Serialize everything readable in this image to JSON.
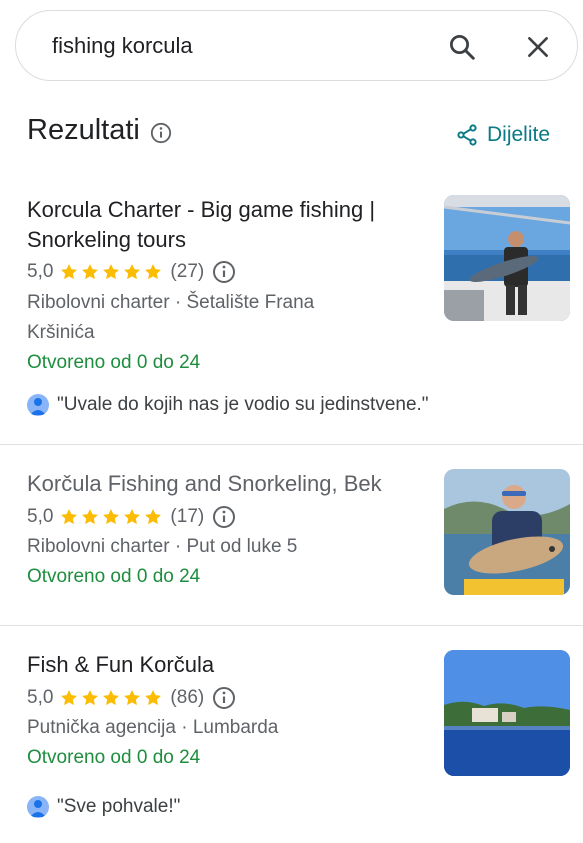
{
  "search": {
    "query": "fishing korcula"
  },
  "header": {
    "title": "Rezultati",
    "share_label": "Dijelite"
  },
  "results": [
    {
      "title": "Korcula Charter - Big game fishing | Snorkeling tours",
      "rating": "5,0",
      "stars": 5,
      "reviews_count": "(27)",
      "meta_line1": "Ribolovni charter · Šetalište Frana",
      "meta_line2": "Kršinića",
      "hours": "Otvoreno od 0 do 24",
      "review": "\"Uvale do kojih nas je vodio su jedinstvene.\""
    },
    {
      "title": "Korčula Fishing and Snorkeling, Bek",
      "rating": "5,0",
      "stars": 5,
      "reviews_count": "(17)",
      "meta_line1": "Ribolovni charter · Put od luke 5",
      "hours": "Otvoreno od 0 do 24"
    },
    {
      "title": "Fish & Fun Korčula",
      "rating": "5,0",
      "stars": 5,
      "reviews_count": "(86)",
      "meta_line1": "Putnička agencija · Lumbarda",
      "hours": "Otvoreno od 0 do 24",
      "review": "\"Sve pohvale!\""
    }
  ],
  "colors": {
    "accent": "#0b7a86",
    "open": "#1e8e3e",
    "star": "#fbbc04"
  },
  "icons": [
    "search-icon",
    "close-icon",
    "info-icon",
    "share-icon",
    "star-icon",
    "user-avatar-icon"
  ]
}
